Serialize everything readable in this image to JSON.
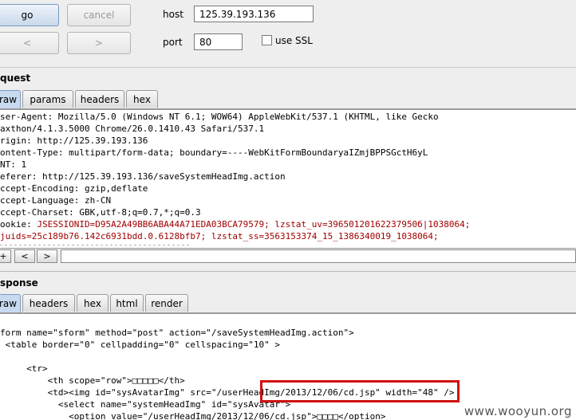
{
  "toolbar": {
    "go_label": "go",
    "cancel_label": "cancel",
    "back_label": "<",
    "forward_label": ">"
  },
  "connection": {
    "host_label": "host",
    "host_value": "125.39.193.136",
    "port_label": "port",
    "port_value": "80",
    "ssl_label": "use SSL",
    "ssl_checked": false
  },
  "request": {
    "title": "quest",
    "tabs": [
      {
        "label": "raw",
        "active": true
      },
      {
        "label": "params",
        "active": false
      },
      {
        "label": "headers",
        "active": false
      },
      {
        "label": "hex",
        "active": false
      }
    ],
    "lines": [
      "ser-Agent: Mozilla/5.0 (Windows NT 6.1; WOW64) AppleWebKit/537.1 (KHTML, like Gecko",
      "axthon/4.1.3.5000 Chrome/26.0.1410.43 Safari/537.1",
      "rigin: http://125.39.193.136",
      "ontent-Type: multipart/form-data; boundary=----WebKitFormBoundaryaIZmjBPPSGctH6yL",
      "NT: 1",
      "eferer: http://125.39.193.136/saveSystemHeadImg.action",
      "ccept-Encoding: gzip,deflate",
      "ccept-Language: zh-CN",
      "ccept-Charset: GBK,utf-8;q=0.7,*;q=0.3"
    ],
    "cookie_lines": [
      {
        "key": "ookie: ",
        "value": "JSESSIONID=D95A2A49BB6ABA44A71EDA03BCA79579; lzstat_uv=39650120162237950б|1038064;"
      },
      {
        "key": "",
        "value": "juids=25c189b76.142c6931bdd.0.6128bfb7; lzstat_ss=3563153374_15_1386340019_1038064;"
      }
    ],
    "nav_plus": "+",
    "nav_back": "<",
    "nav_forward": ">"
  },
  "response": {
    "title": "sponse",
    "tabs": [
      {
        "label": "raw",
        "active": true
      },
      {
        "label": "headers",
        "active": false
      },
      {
        "label": "hex",
        "active": false
      },
      {
        "label": "html",
        "active": false
      },
      {
        "label": "render",
        "active": false
      }
    ],
    "lines": [
      "form name=\"sform\" method=\"post\" action=\"/saveSystemHeadImg.action\">",
      " <table border=\"0\" cellpadding=\"0\" cellspacing=\"10\" >",
      "",
      "     <tr>",
      "         <th scope=\"row\">□□□□□</th>",
      "         <td><img id=\"sysAvatarImg\" src=\"/userHeadImg/2013/12/06/cd.jsp\" width=\"48\" />",
      "           <select name=\"systemHeadImg\" id=\"sysAvatar\">",
      "             <option value=\"/userHeadImg/2013/12/06/cd.jsp\">□□□□</option>"
    ],
    "highlight_text": "/userHeadImg/2013/12/06/cd.jsp"
  },
  "watermark": "www.wooyun.org",
  "colors": {
    "highlight_box": "#d01010",
    "cookie_value": "#a00000",
    "tab_active": "#c8daf0"
  }
}
